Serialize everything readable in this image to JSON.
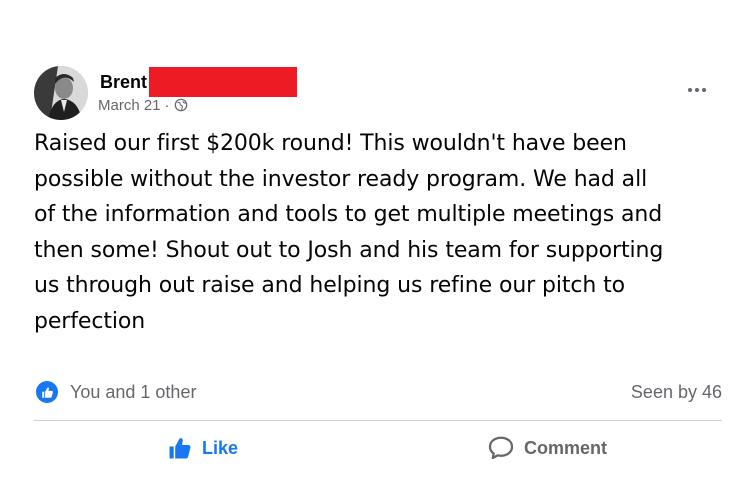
{
  "post": {
    "author_name": "Brent",
    "date": "March 21",
    "separator": "·",
    "privacy_icon": "globe-icon",
    "more_icon": "more-options-icon",
    "text_lines": [
      "Raised our first $200k round! This wouldn't have been",
      "possible without the investor ready program. We had all",
      "of the information and tools to get multiple meetings and",
      "then some! Shout out to Josh and his team for supporting",
      "us through out raise and helping us refine our pitch to",
      "perfection"
    ]
  },
  "reactions": {
    "icon": "like-reaction-icon",
    "summary": "You and 1 other",
    "seen_by": "Seen by 46"
  },
  "actions": {
    "like_label": "Like",
    "comment_label": "Comment"
  },
  "colors": {
    "accent": "#1877f2",
    "secondary_text": "#65676b",
    "redaction": "#ed1c24",
    "divider": "#ced0d4"
  }
}
